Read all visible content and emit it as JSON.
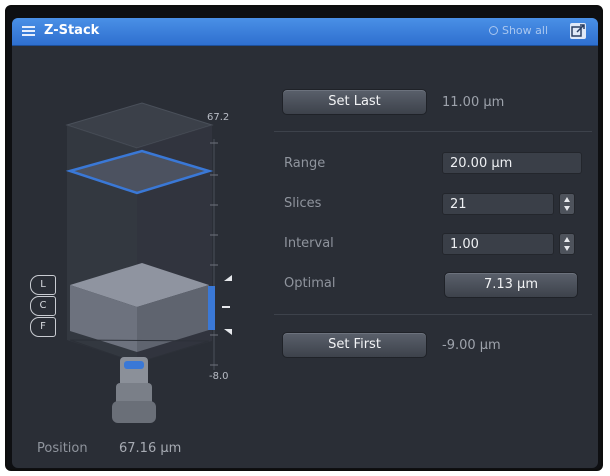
{
  "window": {
    "title": "Z-Stack",
    "show_all": "Show all"
  },
  "scale": {
    "top": "67.2",
    "bottom": "-8.0"
  },
  "markers": [
    "L",
    "C",
    "F"
  ],
  "set_last": {
    "label": "Set Last",
    "value": "11.00 µm"
  },
  "set_first": {
    "label": "Set First",
    "value": "-9.00 µm"
  },
  "range": {
    "label": "Range",
    "value": "20.00 µm"
  },
  "slices": {
    "label": "Slices",
    "value": "21"
  },
  "interval": {
    "label": "Interval",
    "value": "1.00"
  },
  "optimal": {
    "label": "Optimal",
    "value": "7.13 µm"
  },
  "position": {
    "label": "Position",
    "value": "67.16 µm"
  },
  "colors": {
    "title_bar": "#3f86e0",
    "panel": "#2a2e36",
    "slice_plane": "#3a78d6"
  }
}
